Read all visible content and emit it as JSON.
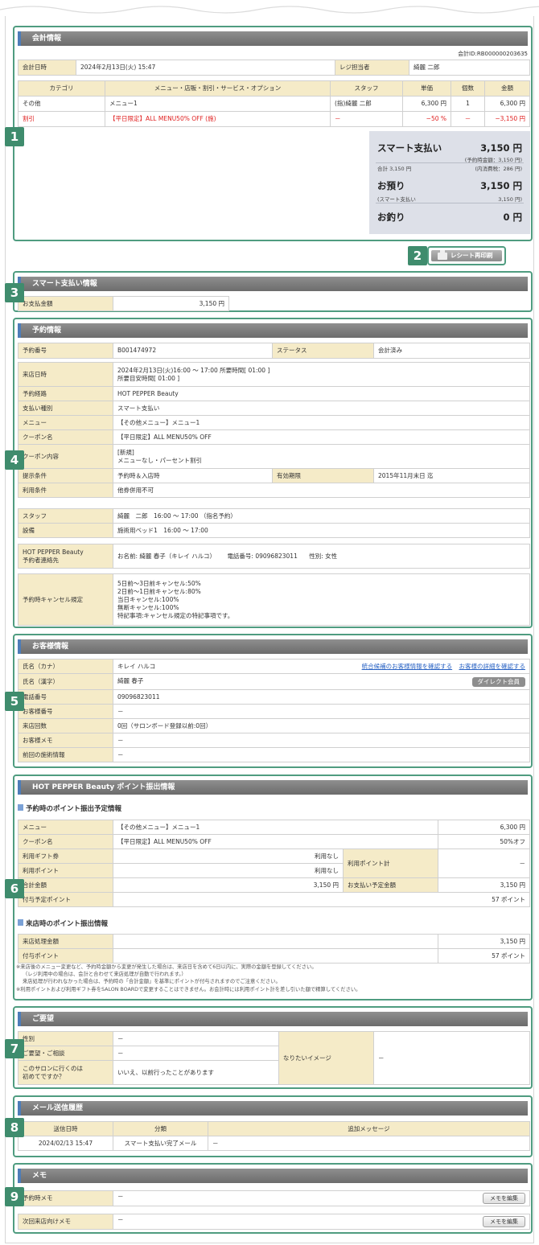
{
  "badges": [
    "1",
    "2",
    "3",
    "4",
    "5",
    "6",
    "7",
    "8",
    "9"
  ],
  "accounting": {
    "title": "会計情報",
    "account_id": "会計ID:RB000000203635",
    "datetime_label": "会計日時",
    "datetime": "2024年2月13日(火) 15:47",
    "cashier_label": "レジ担当者",
    "cashier": "綺麗 二郎",
    "columns": [
      "カテゴリ",
      "メニュー・店販・割引・サービス・オプション",
      "スタッフ",
      "単価",
      "個数",
      "金額"
    ],
    "rows": [
      {
        "category": "その他",
        "item": "メニュー1",
        "staff": "(指)綺麗 二郎",
        "price": "6,300 円",
        "qty": "1",
        "amount": "6,300 円"
      },
      {
        "category": "割引",
        "item": "【平日限定】ALL MENU50% OFF (施)",
        "staff": "－",
        "price": "−50 %",
        "qty": "－",
        "amount": "−3,150 円"
      }
    ],
    "summary": {
      "smart_label": "スマート支払い",
      "smart_value": "3,150 円",
      "reserved_amount": "(予約時金額：3,150 円)",
      "total_label": "合計 3,150 円",
      "tax": "(内消費税：286 円)",
      "deposit_label": "お預り",
      "deposit_value": "3,150 円",
      "deposit_sub_label": "(スマート支払い",
      "deposit_sub_value": "3,150 円)",
      "change_label": "お釣り",
      "change_value": "0 円"
    }
  },
  "reprint": {
    "label": "レシート再印刷"
  },
  "smart_pay": {
    "title": "スマート支払い情報",
    "amount_label": "お支払金額",
    "amount": "3,150 円"
  },
  "reservation": {
    "title": "予約情報",
    "number_label": "予約番号",
    "number": "B001474972",
    "status_label": "ステータス",
    "status": "会計済み",
    "visit_label": "来店日時",
    "visit_line1": "2024年2月13日(火)16:00 ～ 17:00 所要時間[ 01:00 ]",
    "visit_line2": "所要目安時間[ 01:00 ]",
    "route_label": "予約経路",
    "route": "HOT PEPPER Beauty",
    "paytype_label": "支払い種別",
    "paytype": "スマート支払い",
    "menu_label": "メニュー",
    "menu": "【その他メニュー】メニュー1",
    "coupon_label": "クーポン名",
    "coupon": "【平日限定】ALL MENU50% OFF",
    "coupon_content_label": "クーポン内容",
    "coupon_content1": "[新規]",
    "coupon_content2": "メニューなし・パーセント割引",
    "present_label": "提示条件",
    "present": "予約時＆入店時",
    "expiry_label": "有効期限",
    "expiry": "2015年11月末日 迄",
    "usage_label": "利用条件",
    "usage": "他券併用不可",
    "staff_label": "スタッフ",
    "staff": "綺麗　二郎　16:00 ～ 17:00 （指名予約）",
    "equip_label": "設備",
    "equip": "施術用ベッド1　16:00 ～ 17:00",
    "contact_label1": "HOT PEPPER Beauty",
    "contact_label2": "予約者連絡先",
    "contact_name_label": "お名前:",
    "contact_name": "綺麗 春子（キレイ ハルコ）",
    "contact_phone_label": "電話番号:",
    "contact_phone": "09096823011",
    "contact_gender_label": "性別:",
    "contact_gender": "女性",
    "cancel_label": "予約時キャンセル規定",
    "cancel_lines": [
      "5日前～3日前キャンセル:50%",
      "2日前～1日前キャンセル:80%",
      "当日キャンセル:100%",
      "無断キャンセル:100%",
      "特記事項:キャンセル規定の特記事項です。"
    ]
  },
  "customer": {
    "title": "お客様情報",
    "kana_label": "氏名（カナ）",
    "kana": "キレイ ハルコ",
    "link1": "統合候補のお客様情報を確認する",
    "link2": "お客様の詳細を確認する",
    "kanji_label": "氏名（漢字）",
    "kanji": "綺麗 春子",
    "member_badge": "ダイレクト会員",
    "phone_label": "電話番号",
    "phone": "09096823011",
    "custno_label": "お客様番号",
    "custno": "－",
    "visits_label": "来店回数",
    "visits": "0回（サロンボード登録以前:0回）",
    "memo_label": "お客様メモ",
    "memo": "－",
    "prev_label": "前回の施術情報",
    "prev": "－"
  },
  "points": {
    "title": "HOT PEPPER Beauty ポイント振出情報",
    "sub1": "予約時のポイント振出予定情報",
    "menu_label": "メニュー",
    "menu": "【その他メニュー】メニュー1",
    "menu_value": "6,300 円",
    "coupon_label": "クーポン名",
    "coupon": "【平日限定】ALL MENU50% OFF",
    "coupon_value": "50%オフ",
    "gift_label": "利用ギフト券",
    "gift": "利用なし",
    "usepoint_label": "利用ポイント",
    "usepoint": "利用なし",
    "usepoint_total_label": "利用ポイント計",
    "usepoint_total": "－",
    "total_label": "合計金額",
    "total": "3,150 円",
    "pay_plan_label": "お支払い予定金額",
    "pay_plan": "3,150 円",
    "grant_label": "付与予定ポイント",
    "grant": "57 ポイント",
    "sub2": "来店時のポイント振出情報",
    "visit_amount_label": "来店処理金額",
    "visit_amount": "3,150 円",
    "visit_grant_label": "付与ポイント",
    "visit_grant": "57 ポイント",
    "note1": "※来店後のメニュー変更など、予約時金額から変更が発生した場合は、来店日を含めて6日以内に、実際の金額を登録してください。",
    "note2": "（レジ利用中の場合は、会計と合わせて来店処理が自動で行われます。）",
    "note3": "来店処理が行われなかった場合は、予約時の「合計金額」を基準にポイントが付与されますのでご注意ください。",
    "note4": "※利用ポイントおよび利用ギフト券をSALON BOARDで変更することはできません。お会計時には利用ポイント計を差し引いた額で精算してください。"
  },
  "requests": {
    "title": "ご要望",
    "gender_label": "性別",
    "gender": "－",
    "req_label": "ご要望・ご相談",
    "req": "－",
    "first_label1": "このサロンに行くのは",
    "first_label2": "初めてですか？",
    "first": "いいえ、以前行ったことがあります",
    "image_label": "なりたいイメージ",
    "image": "－"
  },
  "mail": {
    "title": "メール送信履歴",
    "columns": [
      "送信日時",
      "分類",
      "追加メッセージ"
    ],
    "rows": [
      {
        "date": "2024/02/13 15:47",
        "kind": "スマート支払い完了メール",
        "msg": "－"
      }
    ]
  },
  "memo": {
    "title": "メモ",
    "res_label": "予約時メモ",
    "res": "－",
    "next_label": "次回来店向けメモ",
    "next": "－",
    "edit_label": "メモを編集"
  }
}
